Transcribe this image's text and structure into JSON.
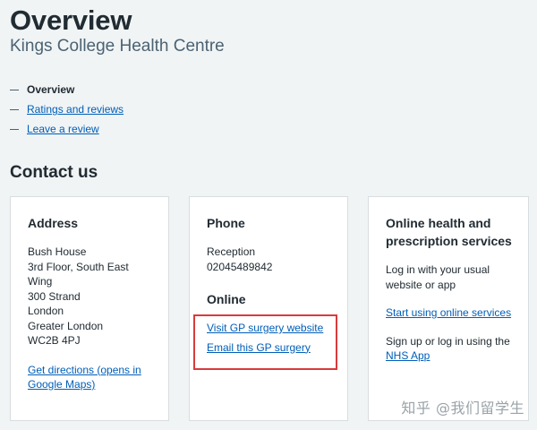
{
  "header": {
    "title": "Overview",
    "subtitle": "Kings College Health Centre"
  },
  "contents": {
    "items": [
      {
        "label": "Overview",
        "current": true
      },
      {
        "label": "Ratings and reviews",
        "current": false
      },
      {
        "label": "Leave a review",
        "current": false
      }
    ]
  },
  "contact": {
    "heading": "Contact us",
    "address": {
      "heading": "Address",
      "lines": [
        "Bush House",
        "3rd Floor, South East",
        "Wing",
        "300 Strand",
        "London",
        "Greater London",
        "WC2B 4PJ"
      ],
      "directions_link": "Get directions (opens in Google Maps)"
    },
    "phone": {
      "heading": "Phone",
      "label": "Reception",
      "number": "02045489842",
      "online_heading": "Online",
      "website_link": "Visit GP surgery website",
      "email_link": "Email this GP surgery"
    },
    "online_services": {
      "heading": "Online health and prescription services",
      "login_text": "Log in with your usual website or app",
      "start_link": "Start using online services",
      "signup_text": "Sign up or log in using the",
      "nhs_app_link": "NHS App"
    }
  },
  "annotation": {
    "highlight_color": "#d83b3b"
  },
  "watermark": {
    "text": "知乎 @我们留学生"
  },
  "colors": {
    "background": "#f0f4f5",
    "text": "#212b32",
    "secondary_text": "#4c6272",
    "link": "#005eb8",
    "card_border": "#d8dde0"
  }
}
